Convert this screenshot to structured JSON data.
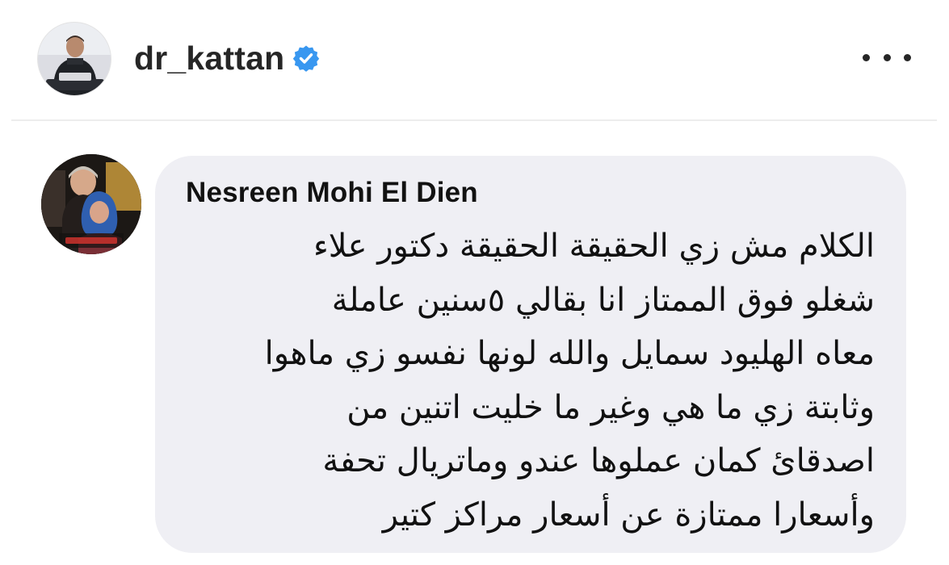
{
  "post": {
    "username": "dr_kattan",
    "verified_icon": "verified-badge-icon",
    "more_icon": "more-options-icon",
    "verified_color": "#3897f0"
  },
  "comment": {
    "author": "Nesreen Mohi El Dien",
    "lines": [
      "الكلام مش زي الحقيقة الحقيقة دكتور علاء",
      "شغلو فوق الممتاز انا بقالي ٥سنين عاملة",
      "معاه الهليود سمايل والله لونها نفسو زي ماهوا",
      "وثابتة زي ما هي وغير ما خليت اتنين من",
      "اصدقائ كمان عملوها عندو وماتريال تحفة",
      "وأسعارا ممتازة عن أسعار مراكز كتير"
    ],
    "bubble_color": "#efeff4"
  }
}
